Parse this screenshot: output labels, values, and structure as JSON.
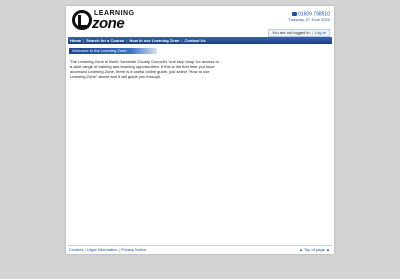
{
  "logo": {
    "top_text": "LEARNING",
    "main_text": "zone"
  },
  "contact": {
    "phone": "01609 798510",
    "date": "Tuesday, 07 June 2022"
  },
  "login": {
    "status": "You are not logged in",
    "login_link": "Log In"
  },
  "nav": {
    "items": [
      {
        "label": "Home"
      },
      {
        "label": "Search for a Course"
      },
      {
        "label": "How to use Learning Zone"
      },
      {
        "label": "Contact Us"
      }
    ]
  },
  "main": {
    "section_title": "Welcome to the Learning Zone",
    "intro": "The Learning Zone is North Yorkshire County Council's 'one stop shop' for access to a wide range of training and learning opportunities. If this is the first time you have accessed Learning Zone, there is a useful online guide, just select \"How to use Learning Zone\" above and it will guide you through."
  },
  "footer": {
    "links": [
      {
        "label": "Cookies"
      },
      {
        "label": "Legal Information"
      },
      {
        "label": "Privacy Notice"
      }
    ],
    "top_of_page": "Top of page"
  },
  "colors": {
    "nav_blue": "#1b3f86",
    "link_blue": "#1e4fa0",
    "background": "#d4d4d4"
  }
}
